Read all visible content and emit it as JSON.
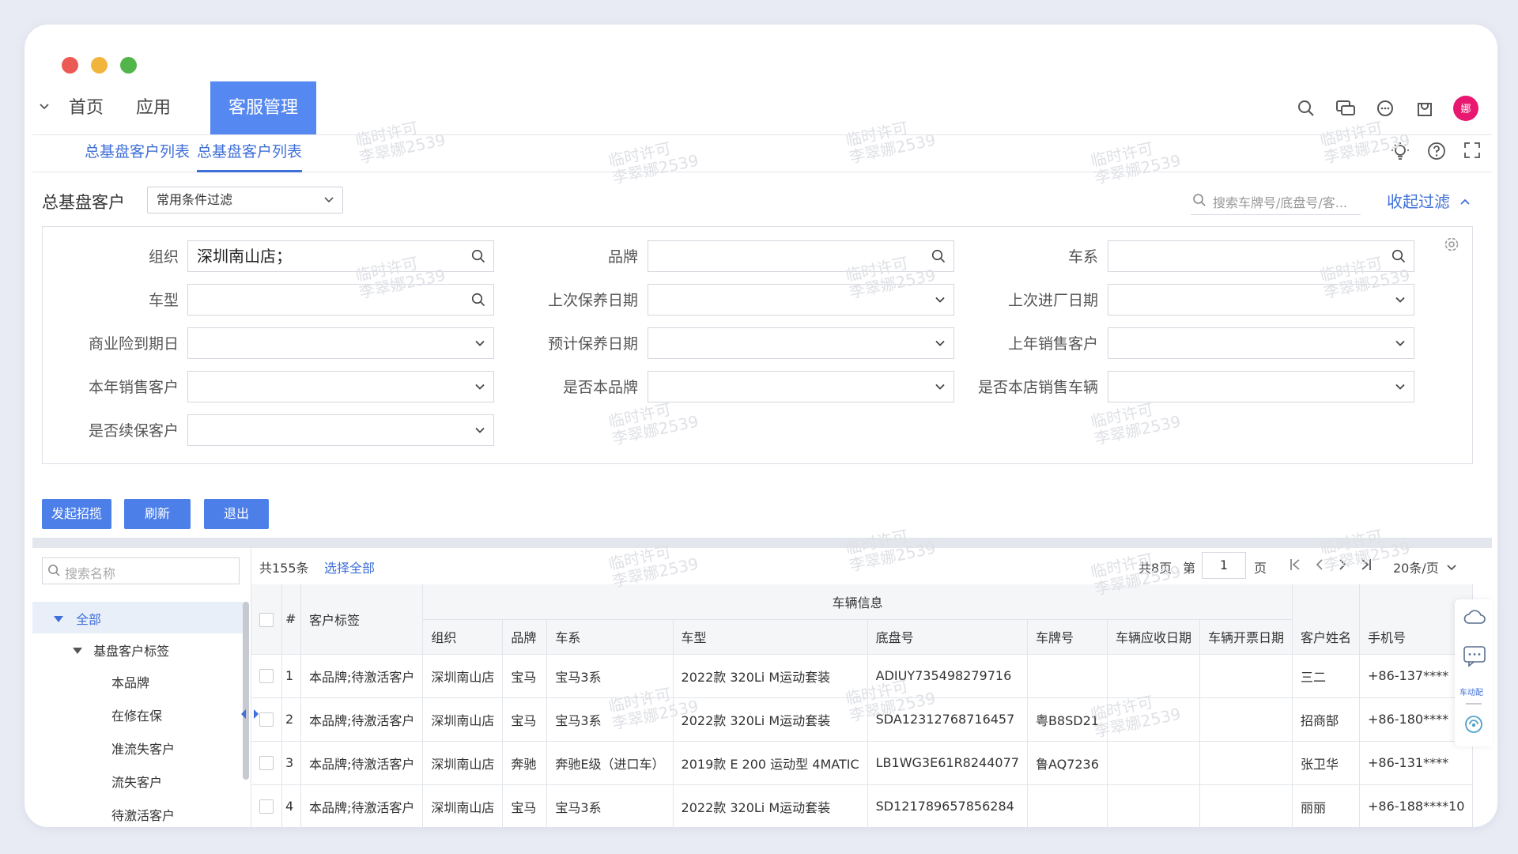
{
  "nav": {
    "tabs": [
      {
        "label": "首页"
      },
      {
        "label": "应用"
      },
      {
        "label": "客服管理"
      }
    ],
    "avatar_text": "娜",
    "accent": "#5588f0"
  },
  "breadcrumb": {
    "items": [
      {
        "label": "总基盘客户列表"
      },
      {
        "label": "总基盘客户列表"
      }
    ]
  },
  "toolbar": {
    "title": "总基盘客户",
    "filter_select": "常用条件过滤",
    "search_placeholder": "搜索车牌号/底盘号/客...",
    "collapse_label": "收起过滤"
  },
  "filters": {
    "org": {
      "label": "组织",
      "value": "深圳南山店；"
    },
    "brand": {
      "label": "品牌",
      "value": ""
    },
    "series": {
      "label": "车系",
      "value": ""
    },
    "model": {
      "label": "车型",
      "value": ""
    },
    "last_maintenance": {
      "label": "上次保养日期",
      "value": ""
    },
    "last_visit": {
      "label": "上次进厂日期",
      "value": ""
    },
    "insurance_due": {
      "label": "商业险到期日",
      "value": ""
    },
    "planned_maintenance": {
      "label": "预计保养日期",
      "value": ""
    },
    "last_year_sales": {
      "label": "上年销售客户",
      "value": ""
    },
    "this_year_sales": {
      "label": "本年销售客户",
      "value": ""
    },
    "is_own_brand": {
      "label": "是否本品牌",
      "value": ""
    },
    "is_store_sold": {
      "label": "是否本店销售车辆",
      "value": ""
    },
    "is_renewal": {
      "label": "是否续保客户",
      "value": ""
    }
  },
  "actions": {
    "start_solicit": "发起招揽",
    "refresh": "刷新",
    "exit": "退出"
  },
  "tree": {
    "search_placeholder": "搜索名称",
    "root": "全部",
    "group": "基盘客户标签",
    "children": [
      "本品牌",
      "在修在保",
      "准流失客户",
      "流失客户",
      "待激活客户"
    ]
  },
  "grid": {
    "total": "共155条",
    "select_all": "选择全部",
    "pages_total": "共8页",
    "page_prefix": "第",
    "current_page": "1",
    "page_suffix": "页",
    "page_size": "20条/页",
    "group_header": "车辆信息",
    "columns": {
      "index": "#",
      "tag": "客户标签",
      "org": "组织",
      "brand": "品牌",
      "series": "车系",
      "model": "车型",
      "vin": "底盘号",
      "plate": "车牌号",
      "receive_date": "车辆应收日期",
      "invoice_date": "车辆开票日期",
      "customer": "客户姓名",
      "phone": "手机号"
    },
    "rows": [
      {
        "index": "1",
        "tag": "本品牌;待激活客户",
        "org": "深圳南山店",
        "brand": "宝马",
        "series": "宝马3系",
        "model": "2022款 320Li M运动套装",
        "vin": "ADIUY735498279716",
        "plate": "",
        "receive_date": "",
        "invoice_date": "",
        "customer": "三二",
        "phone": "+86-137****"
      },
      {
        "index": "2",
        "tag": "本品牌;待激活客户",
        "org": "深圳南山店",
        "brand": "宝马",
        "series": "宝马3系",
        "model": "2022款 320Li M运动套装",
        "vin": "SDA12312768716457",
        "plate": "粤B8SD21",
        "receive_date": "",
        "invoice_date": "",
        "customer": "招商郜",
        "phone": "+86-180****"
      },
      {
        "index": "3",
        "tag": "本品牌;待激活客户",
        "org": "深圳南山店",
        "brand": "奔驰",
        "series": "奔驰E级（进口车）",
        "model": "2019款 E 200 运动型 4MATIC",
        "vin": "LB1WG3E61R8244077",
        "plate": "鲁AQ7236",
        "receive_date": "",
        "invoice_date": "",
        "customer": "张卫华",
        "phone": "+86-131****"
      },
      {
        "index": "4",
        "tag": "本品牌;待激活客户",
        "org": "深圳南山店",
        "brand": "宝马",
        "series": "宝马3系",
        "model": "2022款 320Li M运动套装",
        "vin": "SD121789657856284",
        "plate": "",
        "receive_date": "",
        "invoice_date": "",
        "customer": "丽丽",
        "phone": "+86-188****10"
      }
    ]
  },
  "side_dock": {
    "label": "车动配"
  },
  "watermark": {
    "line1": "临时许可",
    "line2": "李翠娜2539"
  }
}
